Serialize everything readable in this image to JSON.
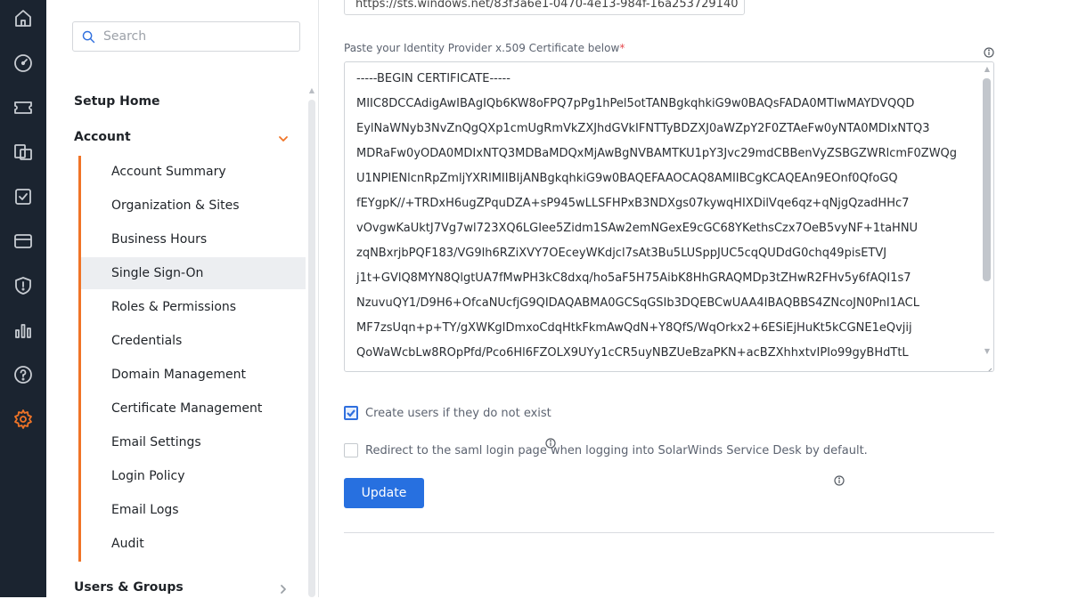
{
  "rail": {
    "icons": [
      "home-icon",
      "dashboard-gauge-icon",
      "ticket-icon",
      "assets-icon",
      "tasks-checkbox-icon",
      "billing-card-icon",
      "security-shield-icon",
      "reports-chart-icon",
      "help-icon",
      "settings-gear-icon"
    ],
    "active": "settings-gear-icon",
    "accent": "#f07427"
  },
  "sidebar": {
    "search_placeholder": "Search",
    "setup_home": "Setup Home",
    "account": {
      "label": "Account",
      "items": [
        {
          "label": "Account Summary"
        },
        {
          "label": "Organization & Sites"
        },
        {
          "label": "Business Hours"
        },
        {
          "label": "Single Sign-On"
        },
        {
          "label": "Roles & Permissions"
        },
        {
          "label": "Credentials"
        },
        {
          "label": "Domain Management"
        },
        {
          "label": "Certificate Management"
        },
        {
          "label": "Email Settings"
        },
        {
          "label": "Login Policy"
        },
        {
          "label": "Email Logs"
        },
        {
          "label": "Audit"
        }
      ],
      "active_item": "Single Sign-On"
    },
    "users_groups": "Users & Groups"
  },
  "main": {
    "url_value": "https://sts.windows.net/83f3a6e1-0470-4e13-984f-16a253729140",
    "cert_label": "Paste your Identity Provider x.509 Certificate below",
    "cert_required_mark": "*",
    "cert_lines": [
      "-----BEGIN CERTIFICATE-----",
      "MIIC8DCCAdigAwIBAgIQb6KW8oFPQ7pPg1hPel5otTANBgkqhkiG9w0BAQsFADA0MTIwMAYDVQQD",
      "EylNaWNyb3NvZnQgQXp1cmUgRmVkZXJhdGVkIFNTTyBDZXJ0aWZpY2F0ZTAeFw0yNTA0MDIxNTQ3",
      "MDRaFw0yODA0MDIxNTQ3MDBaMDQxMjAwBgNVBAMTKU1pY3Jvc29mdCBBenVyZSBGZWRlcmF0ZWQg",
      "U1NPIENlcnRpZmljYXRlMIIBIjANBgkqhkiG9w0BAQEFAAOCAQ8AMIIBCgKCAQEAn9EOnf0QfoGQ",
      "fEYgpK//+TRDxH6ugZPquDZA+sP945wLLSFHPxB3NDXgs07kywqHIXDilVqe6qz+qNjgQzadHHc7",
      "vOvgwKaUktJ7Vg7wl723XQ6LGIee5Zidm1SAw2emNGexE9cGC68YKethsCzx7OeB5vyNF+1taHNU",
      "zqNBxrjbPQF183/VG9lh6RZiXVY7OEceyWKdjcl7sAt3Bu5LUSppJUC5cqQUDdG0chq49pisETVJ",
      "j1t+GVlQ8MYN8QlgtUA7fMwPH3kC8dxq/ho5aF5H75AibK8HhGRAQMDp3tZHwR2FHv5y6fAQI1s7",
      "NzuvuQY1/D9H6+OfcaNUcfjG9QIDAQABMA0GCSqGSIb3DQEBCwUAA4IBAQBBS4ZNcoJN0PnI1ACL",
      "MF7zsUqn+p+TY/gXWKgIDmxoCdqHtkFkmAwQdN+Y8QfS/WqOrkx2+6ESiEjHuKt5kCGNE1eQvjij",
      "QoWaWcbLw8ROpPfd/Pco6Hl6FZOLX9UYy1cCR5uyNBZUeBzaPKN+acBZXhhxtvIPIo99gyBHdTtL"
    ],
    "create_users_label": "Create users if they do not exist",
    "create_users_checked": true,
    "redirect_label": "Redirect to the saml login page when logging into SolarWinds Service Desk by default.",
    "redirect_checked": false,
    "update_label": "Update",
    "button_color": "#2770e0"
  }
}
